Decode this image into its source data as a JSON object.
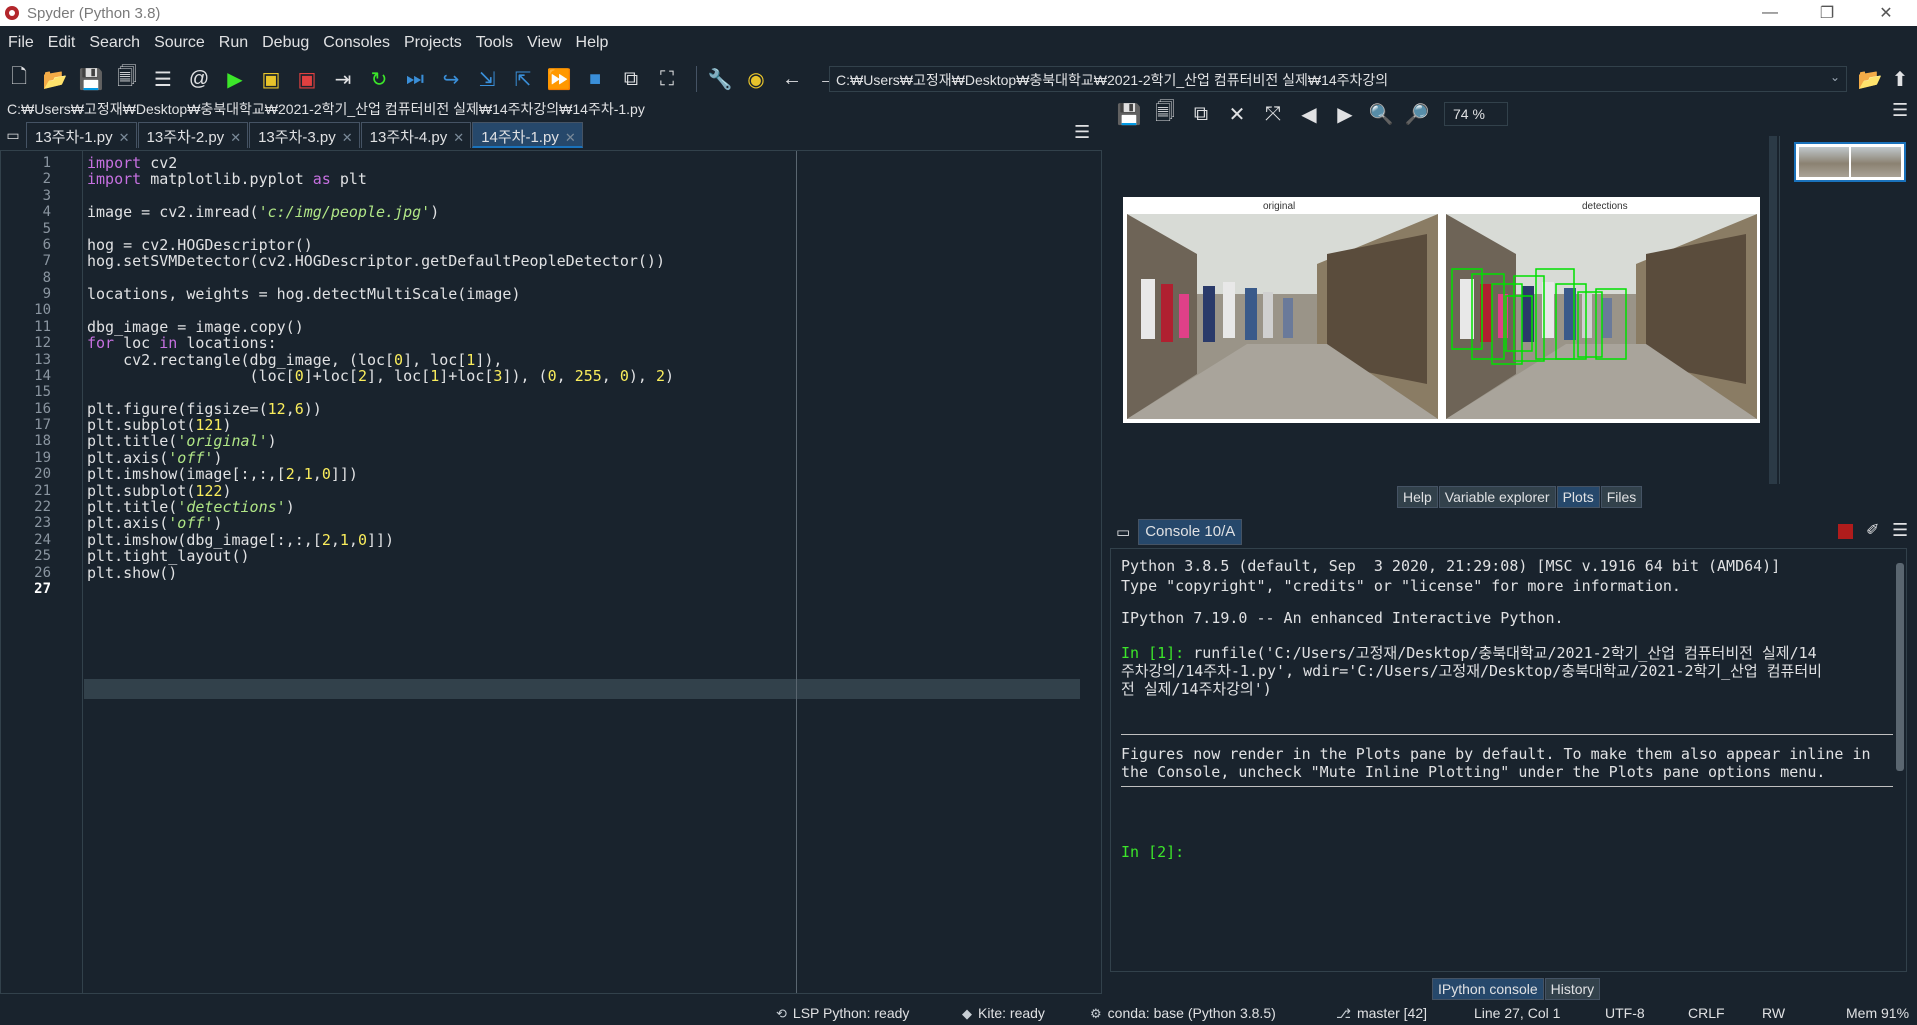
{
  "window": {
    "title": "Spyder (Python 3.8)",
    "controls": [
      "—",
      "❐",
      "✕"
    ]
  },
  "menu": [
    "File",
    "Edit",
    "Search",
    "Source",
    "Run",
    "Debug",
    "Consoles",
    "Projects",
    "Tools",
    "View",
    "Help"
  ],
  "toolbar": {
    "path": "C:₩Users₩고정재₩Desktop₩충북대학교₩2021-2학기_산업 컴퓨터비전 실제₩14주차강의"
  },
  "editor": {
    "file_path": "C:₩Users₩고정재₩Desktop₩충북대학교₩2021-2학기_산업 컴퓨터비전 실제₩14주차강의₩14주차-1.py",
    "tabs": [
      {
        "label": "13주차-1.py",
        "active": false
      },
      {
        "label": "13주차-2.py",
        "active": false
      },
      {
        "label": "13주차-3.py",
        "active": false
      },
      {
        "label": "13주차-4.py",
        "active": false
      },
      {
        "label": "14주차-1.py",
        "active": true
      }
    ],
    "current_line": "27",
    "lines": [
      "import cv2",
      "import matplotlib.pyplot as plt",
      "",
      "image = cv2.imread('c:/img/people.jpg')",
      "",
      "hog = cv2.HOGDescriptor()",
      "hog.setSVMDetector(cv2.HOGDescriptor.getDefaultPeopleDetector())",
      "",
      "locations, weights = hog.detectMultiScale(image)",
      "",
      "dbg_image = image.copy()",
      "for loc in locations:",
      "    cv2.rectangle(dbg_image, (loc[0], loc[1]),",
      "                  (loc[0]+loc[2], loc[1]+loc[3]), (0, 255, 0), 2)",
      "",
      "plt.figure(figsize=(12,6))",
      "plt.subplot(121)",
      "plt.title('original')",
      "plt.axis('off')",
      "plt.imshow(image[:,:,[2,1,0]])",
      "plt.subplot(122)",
      "plt.title('detections')",
      "plt.axis('off')",
      "plt.imshow(dbg_image[:,:,[2,1,0]])",
      "plt.tight_layout()",
      "plt.show()",
      ""
    ]
  },
  "plots": {
    "zoom": "74 %",
    "figure_titles": [
      "original",
      "detections"
    ]
  },
  "pane_tabs": {
    "upper": [
      {
        "label": "Help",
        "active": false
      },
      {
        "label": "Variable explorer",
        "active": false
      },
      {
        "label": "Plots",
        "active": true
      },
      {
        "label": "Files",
        "active": false
      }
    ],
    "lower": [
      {
        "label": "IPython console",
        "active": true
      },
      {
        "label": "History",
        "active": false
      }
    ]
  },
  "console": {
    "tab_label": "Console 10/A",
    "banner_line1": "Python 3.8.5 (default, Sep  3 2020, 21:29:08) [MSC v.1916 64 bit (AMD64)]",
    "banner_line2": "Type \"copyright\", \"credits\" or \"license\" for more information.",
    "ipython_line": "IPython 7.19.0 -- An enhanced Interactive Python.",
    "in1_prompt": "In [1]:",
    "in1_line1": " runfile('C:/Users/고정재/Desktop/충북대학교/2021-2학기_산업 컴퓨터비전 실제/14",
    "in1_line2": "주차강의/14주차-1.py', wdir='C:/Users/고정재/Desktop/충북대학교/2021-2학기_산업 컴퓨터비",
    "in1_line3": "전 실제/14주차강의')",
    "note_line1": "Figures now render in the Plots pane by default. To make them also appear inline in",
    "note_line2": "the Console, uncheck \"Mute Inline Plotting\" under the Plots pane options menu.",
    "in2_prompt": "In [2]:"
  },
  "status": {
    "lsp": "LSP Python: ready",
    "kite": "Kite: ready",
    "conda": "conda: base (Python 3.8.5)",
    "git": "master [42]",
    "position": "Line 27, Col 1",
    "encoding": "UTF-8",
    "eol": "CRLF",
    "rw": "RW",
    "mem": "Mem 91%"
  },
  "colors": {
    "background": "#19232d",
    "accent": "#26486b",
    "prompt": "#3ce62a",
    "keyword": "#c670e0",
    "string": "#b0e686",
    "number": "#faed5c"
  }
}
